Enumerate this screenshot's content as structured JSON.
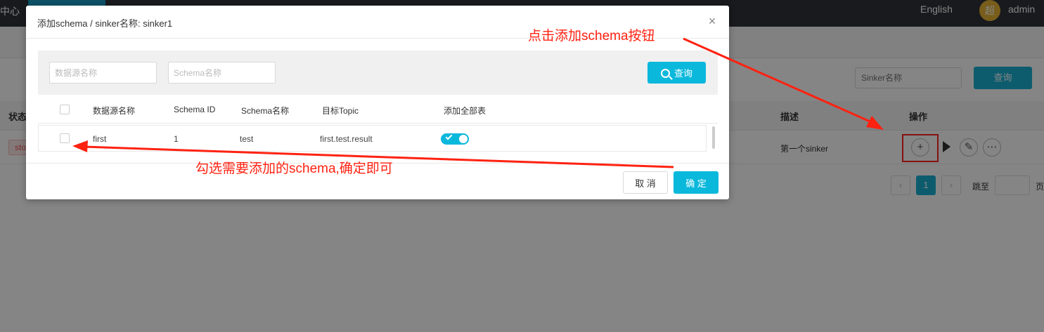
{
  "app": {
    "nav_first": "中心",
    "language": "English",
    "avatar_char": "超",
    "username": "admin"
  },
  "background": {
    "search_placeholder": "Sinker名称",
    "query_label": "查询",
    "columns": {
      "status": "状态",
      "description": "描述",
      "operations": "操作"
    },
    "row": {
      "status": "stop",
      "description": "第一个sinker"
    },
    "pagination": {
      "current_page": "1",
      "jump_label": "跳至",
      "page_suffix": "页"
    }
  },
  "modal": {
    "title": "添加schema / sinker名称: sinker1",
    "close_glyph": "×",
    "search": {
      "datasource_placeholder": "数据源名称",
      "schema_placeholder": "Schema名称",
      "query_label": "查询"
    },
    "table": {
      "headers": [
        "数据源名称",
        "Schema ID",
        "Schema名称",
        "目标Topic",
        "添加全部表"
      ],
      "rows": [
        {
          "datasource": "first",
          "schema_id": "1",
          "schema_name": "test",
          "topic": "first.test.result",
          "add_all_tables": true
        }
      ]
    },
    "footer": {
      "cancel_label": "取 消",
      "ok_label": "确 定"
    }
  },
  "annotations": {
    "top": "点击添加schema按钮",
    "bottom": "勾选需要添加的schema,确定即可"
  },
  "colors": {
    "accent": "#0ab8dc",
    "annotation": "#ff2211",
    "topbar": "#2f3338"
  }
}
